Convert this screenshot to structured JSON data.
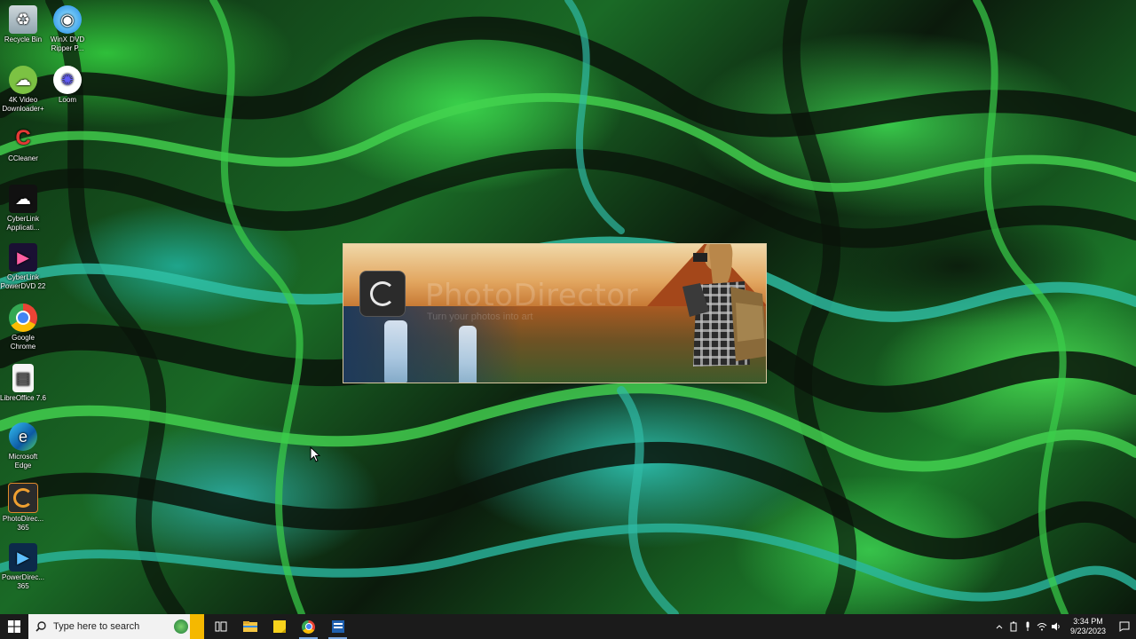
{
  "desktop": {
    "icons": [
      {
        "label": "Recycle Bin",
        "icon": "recycle-bin-icon"
      },
      {
        "label": "WinX DVD Ripper P...",
        "icon": "winx-dvd-icon"
      },
      {
        "label": "4K Video Downloader+",
        "icon": "4k-video-downloader-icon"
      },
      {
        "label": "Loom",
        "icon": "loom-icon"
      },
      {
        "label": "CCleaner",
        "icon": "ccleaner-icon"
      },
      {
        "label": "CyberLink Applicati...",
        "icon": "cyberlink-cloud-icon"
      },
      {
        "label": "CyberLink PowerDVD 22",
        "icon": "powerdvd-icon"
      },
      {
        "label": "Google Chrome",
        "icon": "chrome-icon"
      },
      {
        "label": "LibreOffice 7.6",
        "icon": "libreoffice-icon"
      },
      {
        "label": "Microsoft Edge",
        "icon": "edge-icon"
      },
      {
        "label": "PhotoDirec... 365",
        "icon": "photodirector-icon"
      },
      {
        "label": "PowerDirec... 365",
        "icon": "powerdirector-icon"
      }
    ]
  },
  "splash": {
    "brand": "PhotoDirector",
    "tagline": "Turn your photos into art"
  },
  "taskbar": {
    "search_placeholder": "Type here to search",
    "apps": [
      "task-view-icon",
      "file-explorer-icon",
      "sticky-notes-icon",
      "chrome-icon",
      "photodirector-taskbar-icon"
    ],
    "time": "3:34 PM",
    "date": "9/23/2023"
  },
  "colors": {
    "taskbar_bg": "#1b1b1b",
    "search_bg": "#f2f2f2",
    "accent": "#7aa7e0"
  }
}
